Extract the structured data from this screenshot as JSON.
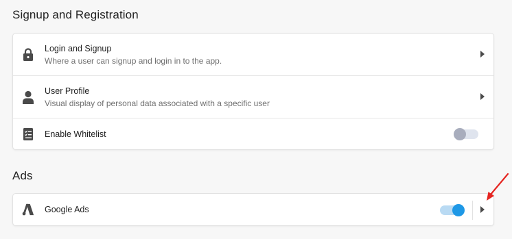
{
  "sections": {
    "signup": {
      "title": "Signup and Registration",
      "rows": [
        {
          "label": "Login and Signup",
          "description": "Where a user can signup and login in to the app.",
          "icon": "lock-icon"
        },
        {
          "label": "User Profile",
          "description": "Visual display of personal data associated with a specific user",
          "icon": "user-icon"
        },
        {
          "label": "Enable Whitelist",
          "icon": "checklist-icon",
          "toggle": "off"
        }
      ]
    },
    "ads": {
      "title": "Ads",
      "rows": [
        {
          "label": "Google Ads",
          "icon": "google-ads-icon",
          "toggle": "on"
        }
      ]
    }
  },
  "colors": {
    "accent": "#1e98e6",
    "annotation_arrow": "#e52521"
  }
}
